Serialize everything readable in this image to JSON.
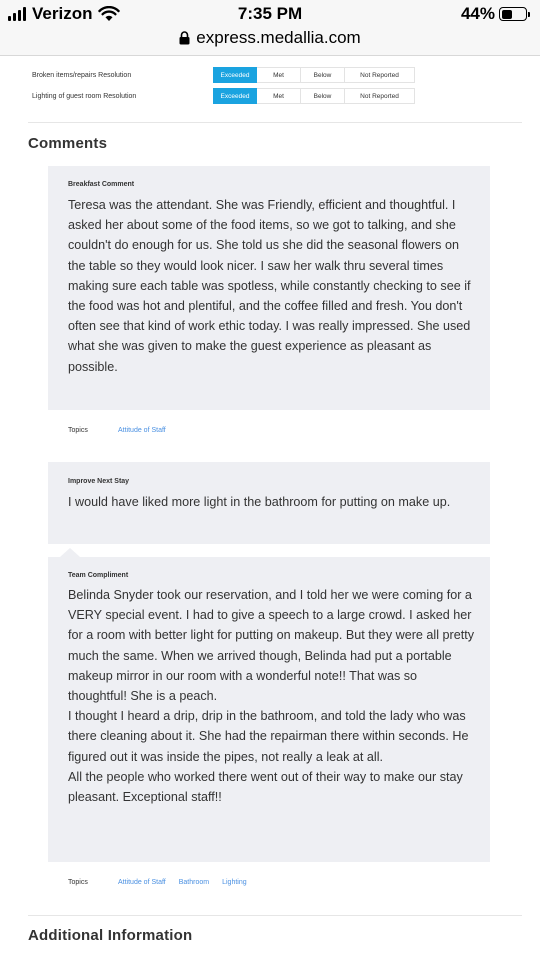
{
  "status_bar": {
    "carrier": "Verizon",
    "time": "7:35 PM",
    "battery": "44%",
    "battery_level": 0.44
  },
  "url_bar": {
    "url": "express.medallia.com"
  },
  "resolution_rows": [
    {
      "label": "Broken items/repairs Resolution",
      "options": [
        "Exceeded",
        "Met",
        "Below",
        "Not Reported"
      ],
      "selected": "Exceeded"
    },
    {
      "label": "Lighting of guest room Resolution",
      "options": [
        "Exceeded",
        "Met",
        "Below",
        "Not Reported"
      ],
      "selected": "Exceeded"
    }
  ],
  "comments": {
    "title": "Comments",
    "items": [
      {
        "label": "Breakfast Comment",
        "text": "Teresa was the attendant. She was Friendly, efficient and thoughtful. I asked her about some of the food items, so we got to talking, and she couldn't do enough for us. She told us she did the seasonal flowers on the table so they would look nicer. I saw her walk thru several times making sure each table was spotless, while constantly checking to see if the food was hot and plentiful, and the coffee filled and fresh. You don't often see that kind of work ethic today. I was really impressed. She used what she was given to make the guest experience as pleasant as possible.",
        "topics_label": "Topics",
        "topics": [
          "Attitude of Staff"
        ]
      },
      {
        "label": "Improve Next Stay",
        "text": "I would have liked more light in the bathroom for putting on make up."
      },
      {
        "label": "Team Compliment",
        "text": "Belinda Snyder took our reservation, and I told her we were coming for a VERY special event. I had to give a speech to a large crowd. I asked her for a room with better light for putting on makeup. But they were all pretty much the same. When we arrived though, Belinda had put a portable makeup mirror in our room with a wonderful note!! That was so thoughtful! She is a peach.\nI thought I heard a drip, drip in the bathroom, and told the lady who was there cleaning about it. She had the repairman there within seconds. He figured out it was inside the pipes, not really a leak at all.\nAll the people who worked there went out of their way to make our stay pleasant. Exceptional staff!!",
        "topics_label": "Topics",
        "topics": [
          "Attitude of Staff",
          "Bathroom",
          "Lighting"
        ]
      }
    ]
  },
  "additional_information": {
    "title": "Additional Information"
  }
}
